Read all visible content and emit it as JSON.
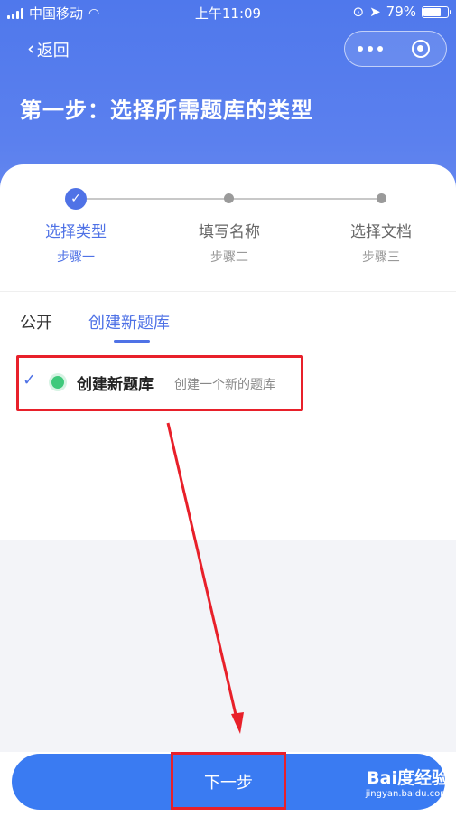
{
  "status_bar": {
    "carrier": "中国移动",
    "time": "上午11:09",
    "battery": "79%",
    "battery_level": 0.79
  },
  "nav": {
    "back_label": "返回"
  },
  "page": {
    "title": "第一步：选择所需题库的类型"
  },
  "steps": [
    {
      "label": "选择类型",
      "sub": "步骤一",
      "state": "done"
    },
    {
      "label": "填写名称",
      "sub": "步骤二",
      "state": "pending"
    },
    {
      "label": "选择文档",
      "sub": "步骤三",
      "state": "pending"
    }
  ],
  "tabs": [
    {
      "label": "公开",
      "selected": false
    },
    {
      "label": "创建新题库",
      "selected": true
    }
  ],
  "option": {
    "title": "创建新题库",
    "description": "创建一个新的题库"
  },
  "footer": {
    "next_label": "下一步"
  },
  "watermark": {
    "brand": "Bai度经验",
    "url": "jingyan.baidu.com"
  },
  "colors": {
    "accent": "#4f72e6",
    "button": "#3a7bf2",
    "highlight": "#e8202a",
    "status_dot": "#3ec97b"
  }
}
